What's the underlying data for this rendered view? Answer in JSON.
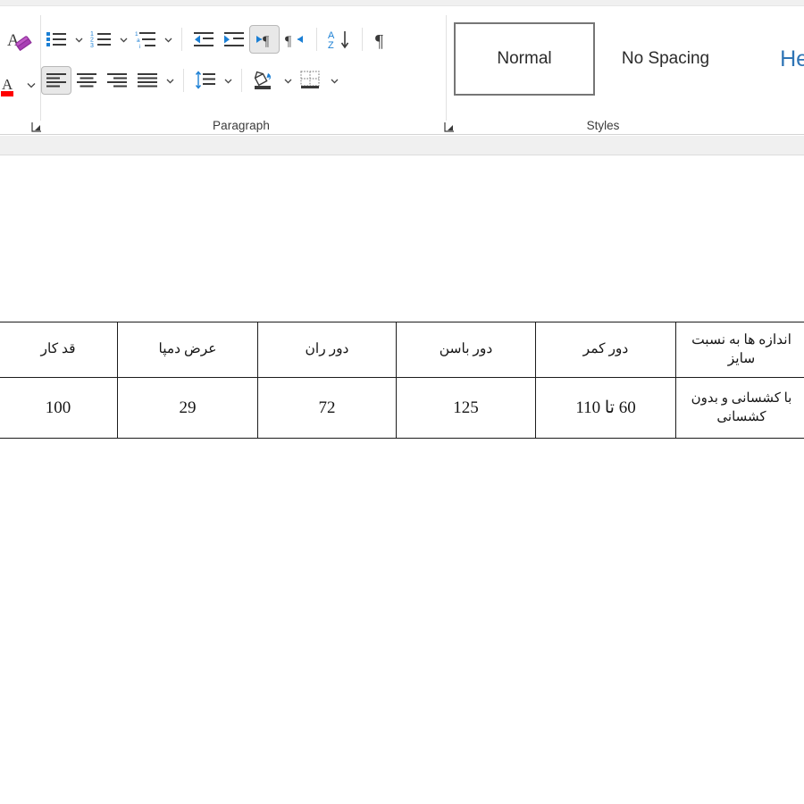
{
  "ribbon": {
    "font_group": {
      "clear_formatting_tooltip": "Clear All Formatting",
      "font_color_tooltip": "Font Color"
    },
    "paragraph_group": {
      "label": "Paragraph",
      "buttons": [
        {
          "name": "bullets",
          "tooltip": "Bullets"
        },
        {
          "name": "numbering",
          "tooltip": "Numbering"
        },
        {
          "name": "multilevel-list",
          "tooltip": "Multilevel List"
        },
        {
          "name": "decrease-indent",
          "tooltip": "Decrease Indent"
        },
        {
          "name": "increase-indent",
          "tooltip": "Increase Indent"
        },
        {
          "name": "right-to-left",
          "tooltip": "Right-to-Left Text Direction"
        },
        {
          "name": "left-to-right",
          "tooltip": "Left-to-Right Text Direction"
        },
        {
          "name": "sort",
          "tooltip": "Sort"
        },
        {
          "name": "show-hide-marks",
          "tooltip": "Show/Hide ¶"
        },
        {
          "name": "align-left",
          "tooltip": "Align Left"
        },
        {
          "name": "align-center",
          "tooltip": "Center"
        },
        {
          "name": "align-right",
          "tooltip": "Align Right"
        },
        {
          "name": "justify",
          "tooltip": "Justify"
        },
        {
          "name": "line-spacing",
          "tooltip": "Line and Paragraph Spacing"
        },
        {
          "name": "shading",
          "tooltip": "Shading"
        },
        {
          "name": "borders",
          "tooltip": "Borders"
        }
      ],
      "selected": [
        "right-to-left",
        "align-left"
      ]
    },
    "styles_group": {
      "label": "Styles",
      "items": [
        {
          "label": "Normal",
          "selected": true
        },
        {
          "label": "No Spacing",
          "selected": false
        },
        {
          "label": "Head",
          "selected": false,
          "accent": "#2e74b5"
        }
      ]
    }
  },
  "document": {
    "table": {
      "direction": "rtl",
      "headers": [
        "اندازه ها به نسبت سایز",
        "دور کمر",
        "دور باسن",
        "دور ران",
        "عرض دمپا",
        "قد کار"
      ],
      "rows": [
        [
          "با کشسانی و بدون کشسانی",
          "60 تا 110",
          "125",
          "72",
          "29",
          "100"
        ]
      ]
    }
  },
  "colors": {
    "ribbon_bg": "#ffffff",
    "accent_blue": "#2e74b5",
    "icon_blue": "#1b7fd4",
    "table_border": "#1c1c1c",
    "selection_bg": "#e8e8e8"
  }
}
